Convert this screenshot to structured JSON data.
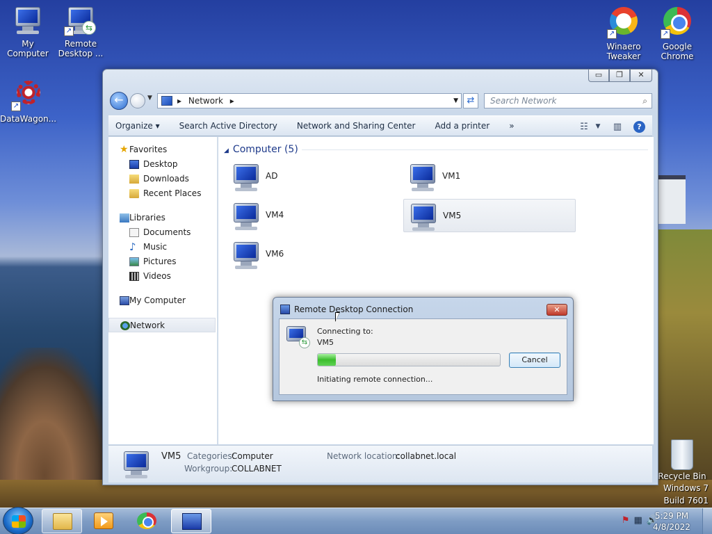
{
  "desktop": {
    "icons": [
      {
        "label": "My Computer"
      },
      {
        "label": "Remote Desktop ..."
      },
      {
        "label": "DataWagon..."
      },
      {
        "label": "Winaero Tweaker"
      },
      {
        "label": "Google Chrome"
      },
      {
        "label": "Recycle Bin"
      }
    ],
    "watermark": {
      "line1": "Windows 7",
      "line2": "Build 7601"
    }
  },
  "explorer": {
    "caption_buttons": {
      "minimize": "▭",
      "maximize": "❐",
      "close": "✕"
    },
    "address": {
      "path_root": "Network",
      "separator": "▸"
    },
    "search": {
      "placeholder": "Search Network",
      "icon": "search-icon"
    },
    "toolbar": {
      "organize": "Organize ▾",
      "items": [
        "Search Active Directory",
        "Network and Sharing Center",
        "Add a printer",
        "»"
      ]
    },
    "nav": {
      "favorites": "Favorites",
      "favorites_items": [
        "Desktop",
        "Downloads",
        "Recent Places"
      ],
      "libraries": "Libraries",
      "libraries_items": [
        "Documents",
        "Music",
        "Pictures",
        "Videos"
      ],
      "my_computer": "My Computer",
      "network": "Network"
    },
    "content": {
      "group_header": "Computer (5)",
      "computers": [
        "AD",
        "VM1",
        "VM4",
        "VM5",
        "VM6"
      ],
      "selected": "VM5"
    },
    "details": {
      "name": "VM5",
      "categories_label": "Categories:",
      "categories_value": "Computer",
      "workgroup_label": "Workgroup:",
      "workgroup_value": "COLLABNET",
      "location_label": "Network location:",
      "location_value": "collabnet.local"
    }
  },
  "rdc_dialog": {
    "title": "Remote Desktop Connection",
    "connecting_label": "Connecting to:",
    "target": "VM5",
    "progress_fraction": 0.1,
    "cancel": "Cancel",
    "status": "Initiating remote connection...",
    "close_glyph": "✕"
  },
  "taskbar": {
    "clock_time": "5:29 PM",
    "clock_date": "4/8/2022",
    "pinned": [
      "folder-icon",
      "media-player-icon",
      "chrome-icon",
      "remote-desktop-icon"
    ]
  }
}
